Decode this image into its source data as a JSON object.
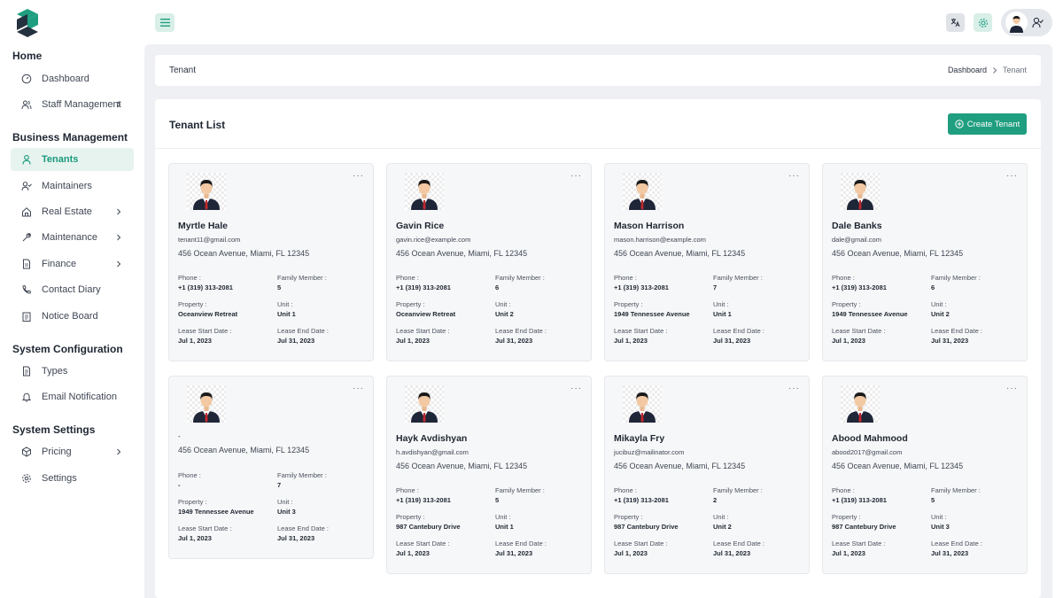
{
  "colors": {
    "accent": "#1f9e80",
    "active_bg": "#e6f3ef",
    "content_bg": "#eef0f4"
  },
  "sidebar": {
    "sections": [
      {
        "title": "Home",
        "items": [
          {
            "label": "Dashboard",
            "icon": "dashboard-icon",
            "chevron": false,
            "active": false
          },
          {
            "label": "Staff Management",
            "icon": "users-icon",
            "chevron": true,
            "active": false
          }
        ]
      },
      {
        "title": "Business Management",
        "items": [
          {
            "label": "Tenants",
            "icon": "user-icon",
            "chevron": false,
            "active": true
          },
          {
            "label": "Maintainers",
            "icon": "user-check-icon",
            "chevron": false,
            "active": false
          },
          {
            "label": "Real Estate",
            "icon": "home-icon",
            "chevron": true,
            "active": false
          },
          {
            "label": "Maintenance",
            "icon": "tool-icon",
            "chevron": true,
            "active": false
          },
          {
            "label": "Finance",
            "icon": "file-icon",
            "chevron": true,
            "active": false
          },
          {
            "label": "Contact Diary",
            "icon": "phone-icon",
            "chevron": false,
            "active": false
          },
          {
            "label": "Notice Board",
            "icon": "clipboard-icon",
            "chevron": false,
            "active": false
          }
        ]
      },
      {
        "title": "System Configuration",
        "items": [
          {
            "label": "Types",
            "icon": "file-text-icon",
            "chevron": false,
            "active": false
          },
          {
            "label": "Email Notification",
            "icon": "bell-icon",
            "chevron": false,
            "active": false
          }
        ]
      },
      {
        "title": "System Settings",
        "items": [
          {
            "label": "Pricing",
            "icon": "package-icon",
            "chevron": true,
            "active": false
          },
          {
            "label": "Settings",
            "icon": "gear-icon",
            "chevron": false,
            "active": false
          }
        ]
      }
    ]
  },
  "breadcrumb": {
    "title": "Tenant",
    "trail": [
      "Dashboard",
      "Tenant"
    ]
  },
  "main": {
    "list_title": "Tenant List",
    "create_label": "Create Tenant"
  },
  "field_labels": {
    "phone": "Phone :",
    "family": "Family Member :",
    "property": "Property :",
    "unit": "Unit :",
    "lease_start": "Lease Start Date :",
    "lease_end": "Lease End Date :"
  },
  "tenants": [
    {
      "name": "Myrtle Hale",
      "email": "tenant11@gmail.com",
      "address": "456 Ocean Avenue, Miami, FL 12345",
      "phone": "+1 (319) 313-2081",
      "family": "5",
      "property": "Oceanview Retreat",
      "unit": "Unit 1",
      "lease_start": "Jul 1, 2023",
      "lease_end": "Jul 31, 2023"
    },
    {
      "name": "Gavin Rice",
      "email": "gavin.rice@example.com",
      "address": "456 Ocean Avenue, Miami, FL 12345",
      "phone": "+1 (319) 313-2081",
      "family": "6",
      "property": "Oceanview Retreat",
      "unit": "Unit 2",
      "lease_start": "Jul 1, 2023",
      "lease_end": "Jul 31, 2023"
    },
    {
      "name": "Mason Harrison",
      "email": "mason.harrison@example.com",
      "address": "456 Ocean Avenue, Miami, FL 12345",
      "phone": "+1 (319) 313-2081",
      "family": "7",
      "property": "1949 Tennessee Avenue",
      "unit": "Unit 1",
      "lease_start": "Jul 1, 2023",
      "lease_end": "Jul 31, 2023"
    },
    {
      "name": "Dale Banks",
      "email": "dale@gmail.com",
      "address": "456 Ocean Avenue, Miami, FL 12345",
      "phone": "+1 (319) 313-2081",
      "family": "6",
      "property": "1949 Tennessee Avenue",
      "unit": "Unit 2",
      "lease_start": "Jul 1, 2023",
      "lease_end": "Jul 31, 2023"
    },
    {
      "name": "-",
      "email": "",
      "address": "456 Ocean Avenue, Miami, FL 12345",
      "phone": "-",
      "family": "7",
      "property": "1949 Tennessee Avenue",
      "unit": "Unit 3",
      "lease_start": "Jul 1, 2023",
      "lease_end": "Jul 31, 2023"
    },
    {
      "name": "Hayk Avdishyan",
      "email": "h.avdishyan@gmail.com",
      "address": "456 Ocean Avenue, Miami, FL 12345",
      "phone": "+1 (319) 313-2081",
      "family": "5",
      "property": "987 Cantebury Drive",
      "unit": "Unit 1",
      "lease_start": "Jul 1, 2023",
      "lease_end": "Jul 31, 2023"
    },
    {
      "name": "Mikayla Fry",
      "email": "jucibuz@mailinator.com",
      "address": "456 Ocean Avenue, Miami, FL 12345",
      "phone": "+1 (319) 313-2081",
      "family": "2",
      "property": "987 Cantebury Drive",
      "unit": "Unit 2",
      "lease_start": "Jul 1, 2023",
      "lease_end": "Jul 31, 2023"
    },
    {
      "name": "Abood Mahmood",
      "email": "abood2017@gmail.com",
      "address": "456 Ocean Avenue, Miami, FL 12345",
      "phone": "+1 (319) 313-2081",
      "family": "5",
      "property": "987 Cantebury Drive",
      "unit": "Unit 3",
      "lease_start": "Jul 1, 2023",
      "lease_end": "Jul 31, 2023"
    }
  ]
}
